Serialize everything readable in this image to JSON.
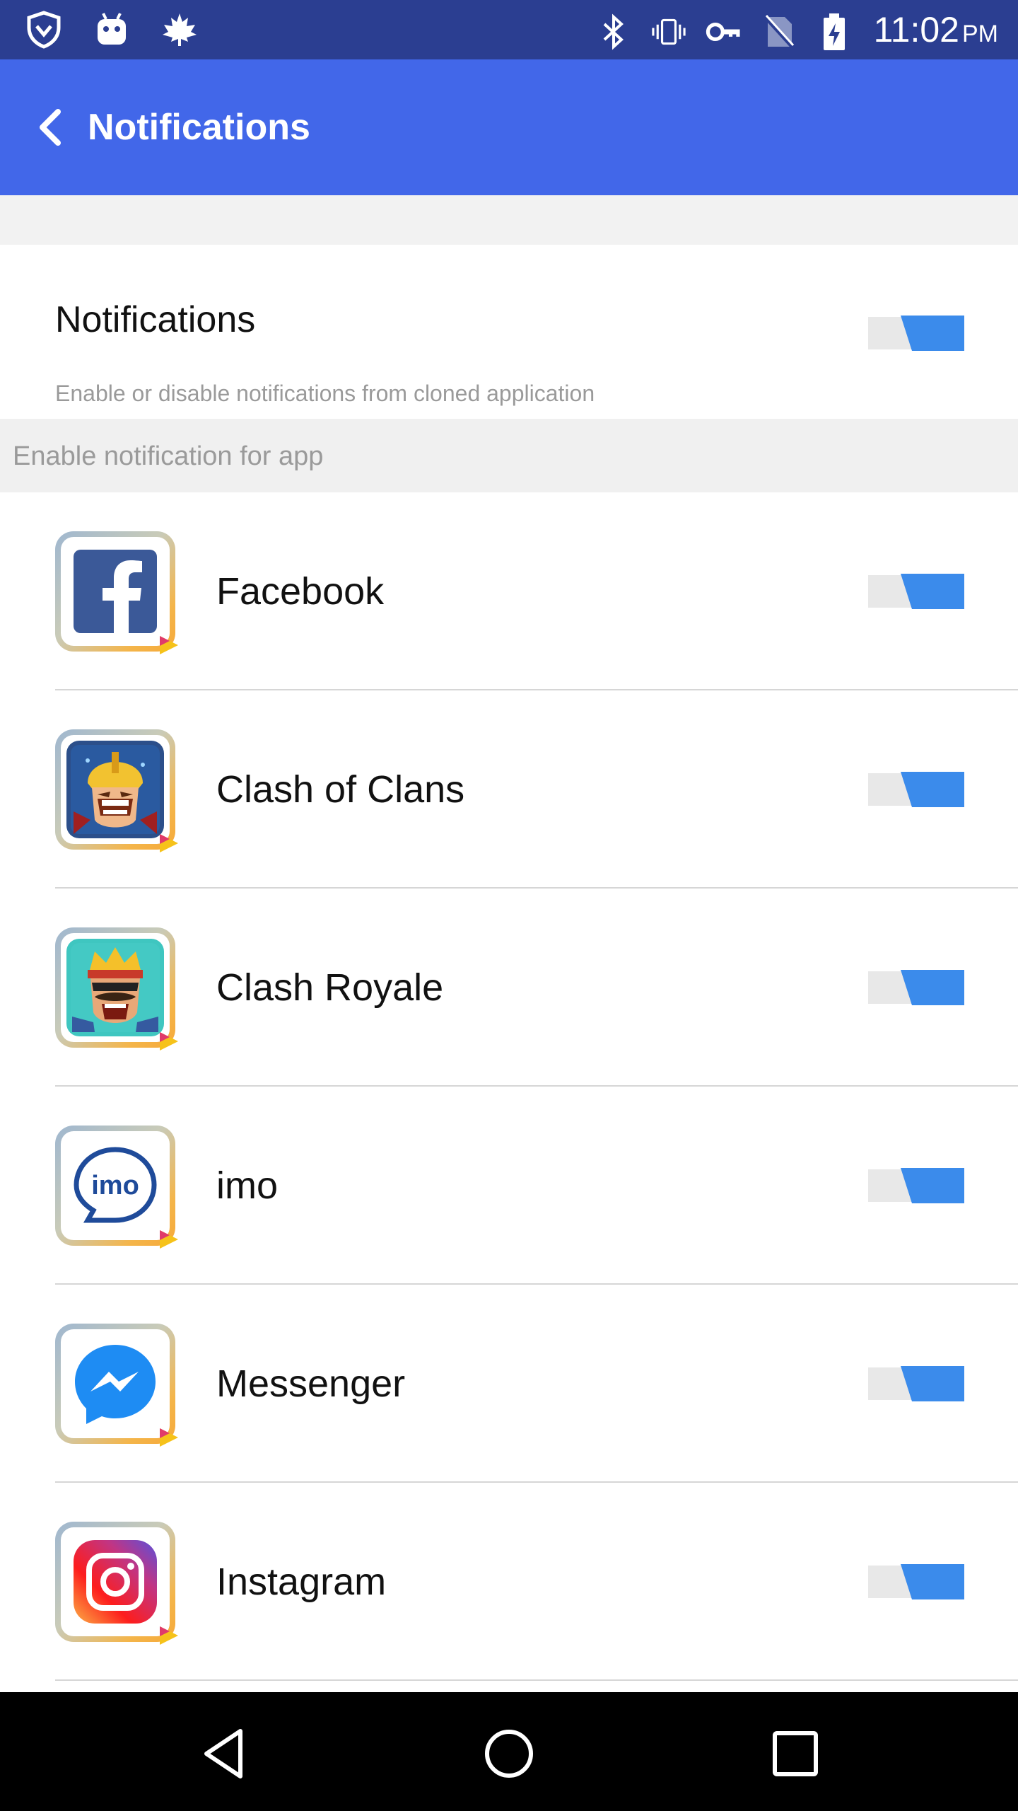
{
  "status_bar": {
    "time": "11:02",
    "ampm": "PM",
    "left_icons": [
      "shield-icon",
      "android-icon",
      "maple-leaf-icon"
    ],
    "right_icons": [
      "bluetooth-icon",
      "vibrate-icon",
      "vpn-key-icon",
      "no-sim-icon",
      "battery-charging-icon"
    ]
  },
  "app_bar": {
    "title": "Notifications",
    "back_icon": "chevron-left-icon",
    "background": "#4267e9"
  },
  "main_setting": {
    "title": "Notifications",
    "description": "Enable or disable notifications from cloned application",
    "enabled": true
  },
  "section": {
    "label": "Enable notification for app"
  },
  "apps": [
    {
      "name": "Facebook",
      "icon": "facebook-icon",
      "enabled": true
    },
    {
      "name": "Clash of Clans",
      "icon": "clash-of-clans-icon",
      "enabled": true
    },
    {
      "name": "Clash Royale",
      "icon": "clash-royale-icon",
      "enabled": true
    },
    {
      "name": "imo",
      "icon": "imo-icon",
      "icon_text": "imo",
      "enabled": true
    },
    {
      "name": "Messenger",
      "icon": "messenger-icon",
      "enabled": true
    },
    {
      "name": "Instagram",
      "icon": "instagram-icon",
      "enabled": true
    }
  ],
  "nav_bar": {
    "icons": [
      "back-triangle-icon",
      "home-circle-icon",
      "recents-square-icon"
    ]
  },
  "colors": {
    "status_bar": "#2b3e91",
    "accent": "#4267e9",
    "toggle_on": "#3b8beb",
    "toggle_track": "#e6e6e6"
  }
}
